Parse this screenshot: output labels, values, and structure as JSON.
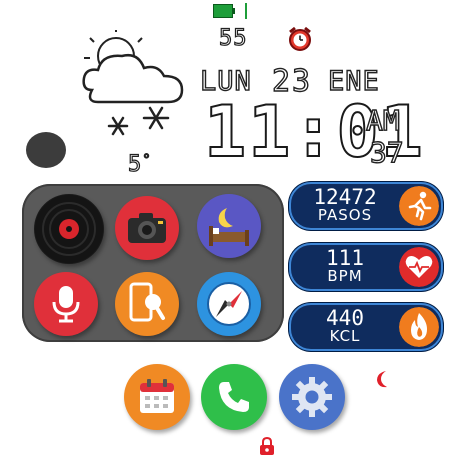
{
  "status": {
    "battery_level": "55",
    "battery_icon": "battery-icon",
    "signal_icon": "signal-icon",
    "alarm_icon": "alarm-clock-icon"
  },
  "weather": {
    "temperature": "5",
    "unit": "°",
    "icon": "cloud-snow-icon"
  },
  "date": {
    "weekday": "LUN",
    "day": "23",
    "month": "ENE"
  },
  "time": {
    "hours": "11",
    "separator": ":",
    "minutes": "01",
    "ampm": "AM",
    "seconds": "37"
  },
  "apps": [
    {
      "name": "music",
      "icon": "vinyl-record-icon",
      "color": "#1a1a1a"
    },
    {
      "name": "camera",
      "icon": "camera-icon",
      "color": "#e0303a"
    },
    {
      "name": "sleep",
      "icon": "moon-bed-icon",
      "color": "#5a57c4"
    },
    {
      "name": "voice",
      "icon": "microphone-icon",
      "color": "#e0303a"
    },
    {
      "name": "phone-finder",
      "icon": "phone-search-icon",
      "color": "#f08a24"
    },
    {
      "name": "compass",
      "icon": "compass-icon",
      "color": "#2d93e0"
    }
  ],
  "stats": {
    "steps": {
      "value": "12472",
      "label": "PASOS",
      "icon": "running-man-icon",
      "color": "#f07c1e"
    },
    "heart": {
      "value": "111",
      "label": "BPM",
      "icon": "heart-icon",
      "color": "#e02b2b"
    },
    "calories": {
      "value": "440",
      "label": "KCL",
      "icon": "flame-icon",
      "color": "#f07c1e"
    }
  },
  "dock": [
    {
      "name": "calendar",
      "icon": "calendar-icon",
      "color": "#f08a24"
    },
    {
      "name": "phone",
      "icon": "phone-icon",
      "color": "#2fbf4a"
    },
    {
      "name": "settings",
      "icon": "gear-icon",
      "color": "#4a73c9"
    }
  ]
}
